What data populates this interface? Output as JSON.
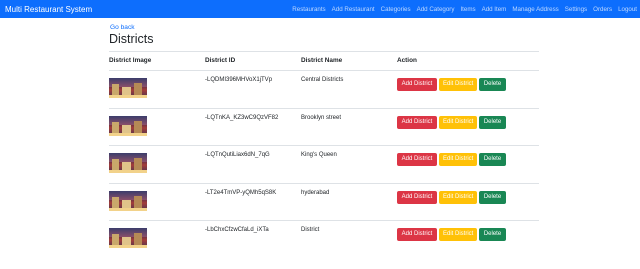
{
  "navbar": {
    "brand": "Multi Restaurant System",
    "links": [
      "Restaurants",
      "Add Restaurant",
      "Categories",
      "Add Category",
      "Items",
      "Add Item",
      "Manage Address",
      "Settings",
      "Orders",
      "Logout"
    ]
  },
  "page": {
    "go_back": "Go back",
    "title": "Districts"
  },
  "table": {
    "headers": [
      "District Image",
      "District ID",
      "District Name",
      "Action"
    ],
    "rows": [
      {
        "image": "district-photo-icon",
        "id": "-LQDMI396MHVoX1jTVp",
        "name": "Central Districts"
      },
      {
        "image": "district-photo-icon",
        "id": "-LQTnKA_KZ3wC9QzVF82",
        "name": "Brooklyn street"
      },
      {
        "image": "district-photo-icon",
        "id": "-LQTnQutiLiax6dN_7qG",
        "name": "King's Queen"
      },
      {
        "image": "district-photo-icon",
        "id": "-LT2e4TmVP-yQMh5qS8K",
        "name": "hyderabad"
      },
      {
        "image": "district-photo-icon",
        "id": "-LbChxCfzwCfaLd_iXTa",
        "name": "District"
      }
    ],
    "actions": {
      "add": "Add District",
      "edit": "Edit District",
      "delete": "Delete"
    }
  },
  "colors": {
    "navbar": "#0d6efd",
    "add_button": "#dc3545",
    "edit_button": "#ffc107",
    "delete_button": "#198754"
  }
}
